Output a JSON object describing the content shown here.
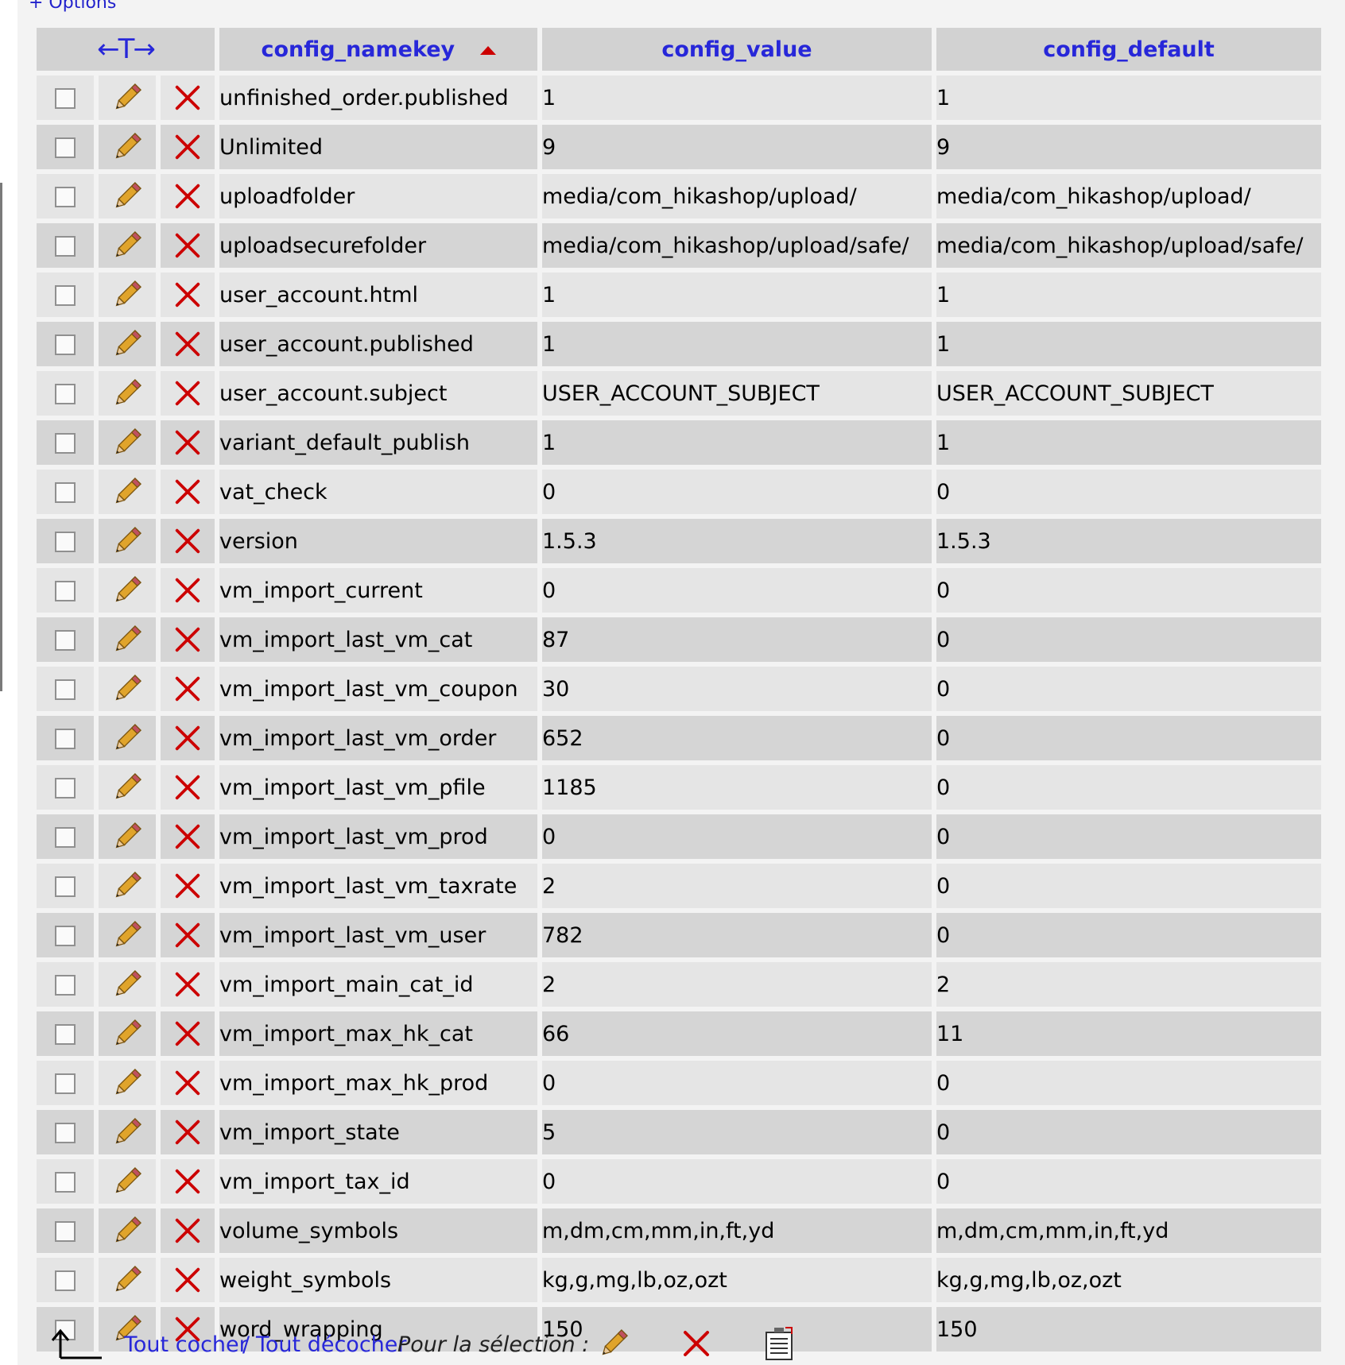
{
  "options_label": "+ Options",
  "table": {
    "column_resizer": "←T→",
    "headers": {
      "namekey": "config_namekey",
      "value": "config_value",
      "default": "config_default"
    },
    "sort": {
      "column": "config_namekey",
      "direction": "ascending"
    },
    "rows": [
      {
        "key": "unfinished_order.published",
        "value": "1",
        "default": "1"
      },
      {
        "key": "Unlimited",
        "value": "9",
        "default": "9"
      },
      {
        "key": "uploadfolder",
        "value": "media/com_hikashop/upload/",
        "default": "media/com_hikashop/upload/"
      },
      {
        "key": "uploadsecurefolder",
        "value": "media/com_hikashop/upload/safe/",
        "default": "media/com_hikashop/upload/safe/"
      },
      {
        "key": "user_account.html",
        "value": "1",
        "default": "1"
      },
      {
        "key": "user_account.published",
        "value": "1",
        "default": "1"
      },
      {
        "key": "user_account.subject",
        "value": "USER_ACCOUNT_SUBJECT",
        "default": "USER_ACCOUNT_SUBJECT"
      },
      {
        "key": "variant_default_publish",
        "value": "1",
        "default": "1"
      },
      {
        "key": "vat_check",
        "value": "0",
        "default": "0"
      },
      {
        "key": "version",
        "value": "1.5.3",
        "default": "1.5.3"
      },
      {
        "key": "vm_import_current",
        "value": "0",
        "default": "0"
      },
      {
        "key": "vm_import_last_vm_cat",
        "value": "87",
        "default": "0"
      },
      {
        "key": "vm_import_last_vm_coupon",
        "value": "30",
        "default": "0"
      },
      {
        "key": "vm_import_last_vm_order",
        "value": "652",
        "default": "0"
      },
      {
        "key": "vm_import_last_vm_pfile",
        "value": "1185",
        "default": "0"
      },
      {
        "key": "vm_import_last_vm_prod",
        "value": "0",
        "default": "0"
      },
      {
        "key": "vm_import_last_vm_taxrate",
        "value": "2",
        "default": "0"
      },
      {
        "key": "vm_import_last_vm_user",
        "value": "782",
        "default": "0"
      },
      {
        "key": "vm_import_main_cat_id",
        "value": "2",
        "default": "2"
      },
      {
        "key": "vm_import_max_hk_cat",
        "value": "66",
        "default": "11"
      },
      {
        "key": "vm_import_max_hk_prod",
        "value": "0",
        "default": "0"
      },
      {
        "key": "vm_import_state",
        "value": "5",
        "default": "0"
      },
      {
        "key": "vm_import_tax_id",
        "value": "0",
        "default": "0"
      },
      {
        "key": "volume_symbols",
        "value": "m,dm,cm,mm,in,ft,yd",
        "default": "m,dm,cm,mm,in,ft,yd"
      },
      {
        "key": "weight_symbols",
        "value": "kg,g,mg,lb,oz,ozt",
        "default": "kg,g,mg,lb,oz,ozt"
      },
      {
        "key": "word_wrapping",
        "value": "150",
        "default": "150"
      }
    ]
  },
  "footer": {
    "check_all": "Tout cocher",
    "separator": "/",
    "uncheck_all": "Tout décocher",
    "with_selected": "Pour la sélection :"
  },
  "icons": {
    "edit": "pencil-icon",
    "delete": "delete-x-icon",
    "export": "export-icon",
    "arrow": "select-arrow-icon"
  },
  "colors": {
    "link": "#2727d9",
    "delete": "#cc0000",
    "header_bg": "#d2d2d2",
    "row_odd": "#e5e5e5",
    "row_even": "#d5d5d5"
  }
}
